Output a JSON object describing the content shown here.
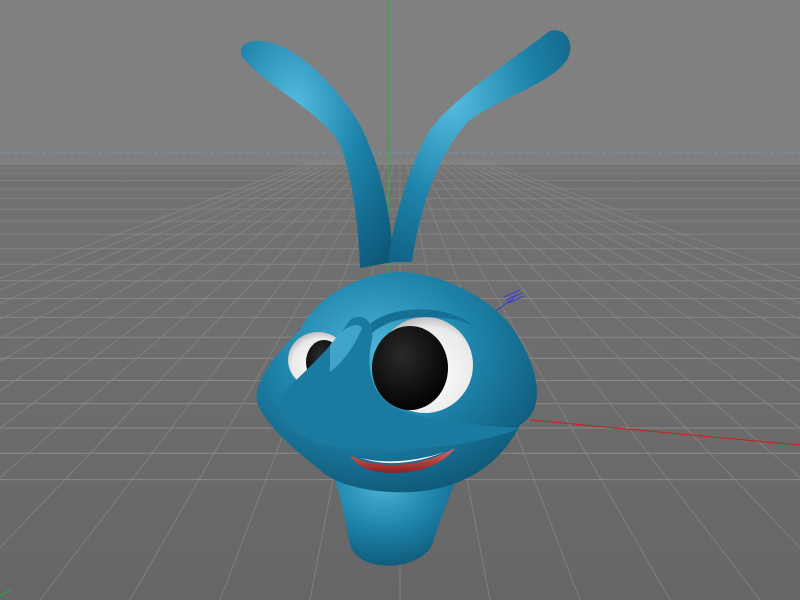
{
  "viewport": {
    "view_mode": "perspective",
    "background_color": "#7d7d7d",
    "floor_color": "#6e6e6e",
    "grid_color": "#8a8a8a",
    "horizon_line_color": "#5aa0d8"
  },
  "axes": {
    "x_color": "#c81e1e",
    "y_color": "#22b43a",
    "z_color": "#3a3ad8"
  },
  "scene_object": {
    "type": "3d-character-head",
    "description_icon": "alien-creature-model",
    "skin_color": "#1f7fa3",
    "eye_white_color": "#ffffff",
    "pupil_color": "#0a0a0a",
    "mouth_color": "#c24a4a"
  }
}
